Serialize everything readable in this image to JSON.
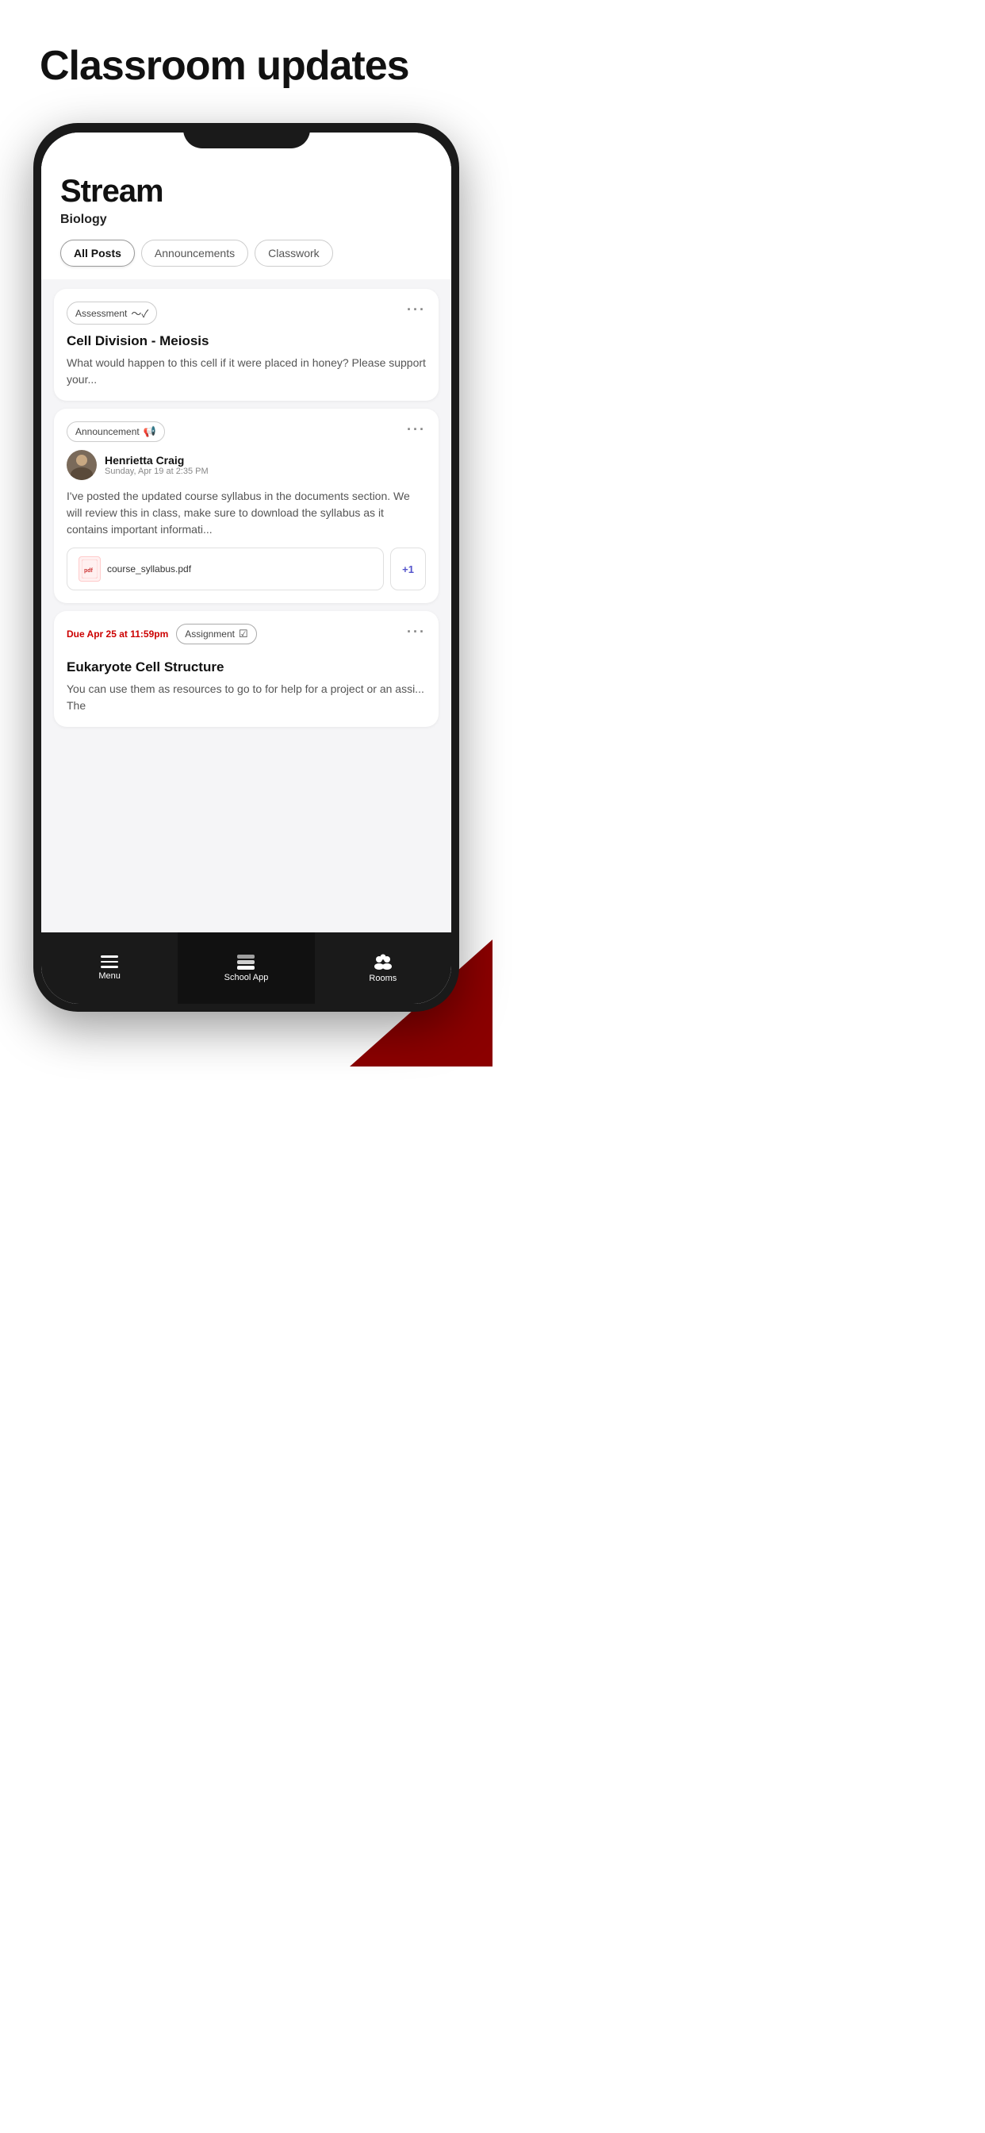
{
  "page": {
    "heading": "Classroom updates",
    "background": "#ffffff"
  },
  "stream": {
    "title": "Stream",
    "subtitle": "Biology"
  },
  "tabs": [
    {
      "label": "All Posts",
      "active": true
    },
    {
      "label": "Announcements",
      "active": false
    },
    {
      "label": "Classwork",
      "active": false
    }
  ],
  "posts": [
    {
      "type": "assessment",
      "tag": "Assessment",
      "tag_icon": "chart-icon",
      "title": "Cell Division - Meiosis",
      "body": "What would happen to this cell if it were placed in honey? Please support your..."
    },
    {
      "type": "announcement",
      "tag": "Announcement",
      "tag_icon": "megaphone-icon",
      "author_name": "Henrietta Craig",
      "author_date": "Sunday, Apr 19 at 2:35 PM",
      "body": "I've posted the updated course syllabus in the documents section. We will review this in class, make sure to download the syllabus as it contains important informati...",
      "attachment_name": "course_syllabus.pdf",
      "attachment_extra": "+1"
    },
    {
      "type": "assignment",
      "due_label": "Due Apr 25 at 11:59pm",
      "tag": "Assignment",
      "tag_icon": "clipboard-icon",
      "title": "Eukaryote Cell Structure",
      "body": "You can use them as resources to go to for help for a project or an assi... The"
    }
  ],
  "nav": {
    "items": [
      {
        "id": "menu",
        "label": "Menu",
        "icon": "hamburger-icon"
      },
      {
        "id": "school-app",
        "label": "School App",
        "icon": "stack-icon"
      },
      {
        "id": "rooms",
        "label": "Rooms",
        "icon": "rooms-icon"
      }
    ]
  }
}
